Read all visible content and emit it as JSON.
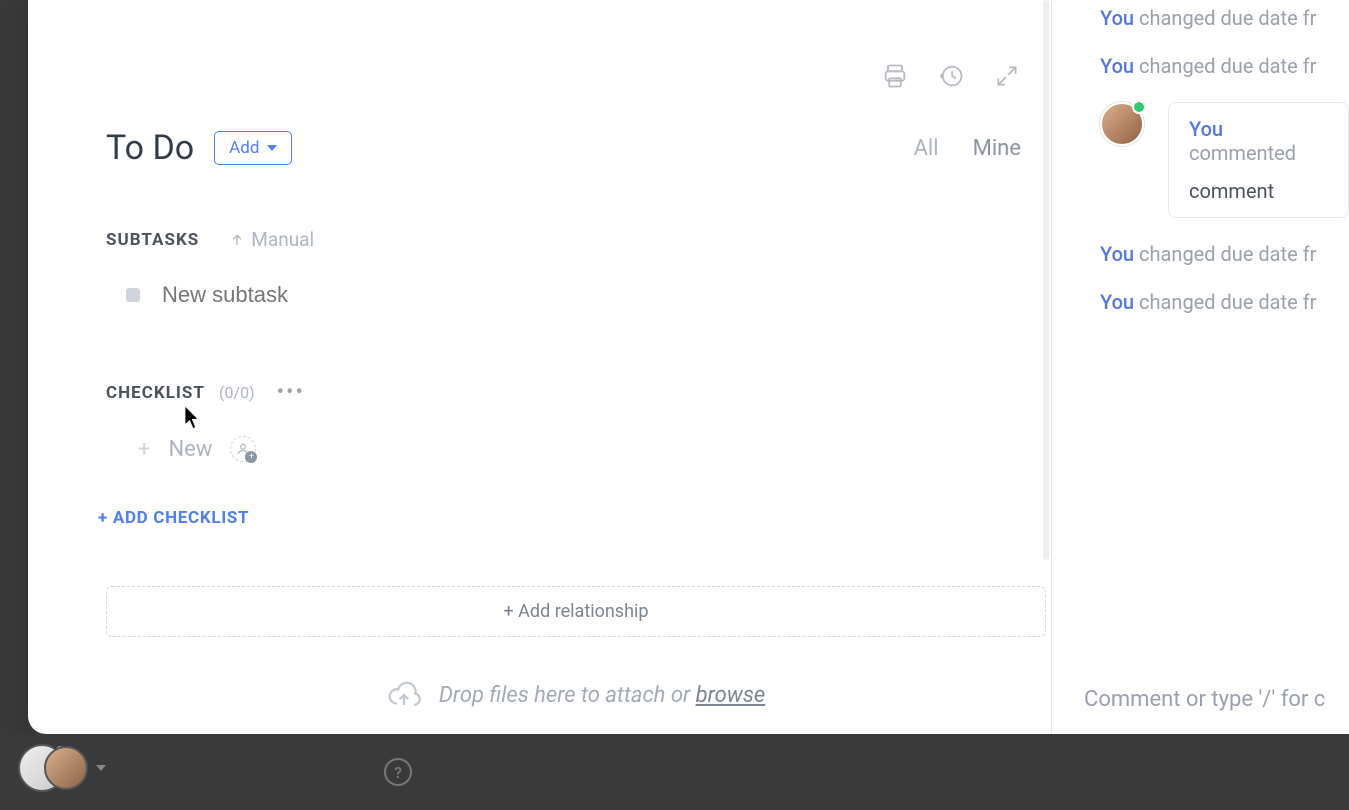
{
  "title": "To Do",
  "add_button_label": "Add",
  "filters": {
    "all": "All",
    "mine": "Mine"
  },
  "subtasks": {
    "label": "SUBTASKS",
    "sort": "Manual",
    "placeholder": "New subtask"
  },
  "checklist": {
    "label": "CHECKLIST",
    "count": "(0/0)",
    "item_placeholder": "New",
    "add_label": "+ ADD CHECKLIST"
  },
  "relationship_label": "+ Add relationship",
  "dropzone": {
    "text": "Drop files here to attach or ",
    "link": "browse"
  },
  "activity": {
    "you": "You",
    "changed_due": "changed due date fr",
    "commented": "commented",
    "comment_body": "comment"
  },
  "comment_input_placeholder": "Comment or type '/' for c",
  "icons": {
    "print": "print-icon",
    "history": "history-icon",
    "expand": "expand-icon",
    "sort_up": "arrow-up-icon",
    "assign": "assign-person-icon",
    "upload": "cloud-upload-icon",
    "more": "•••"
  }
}
